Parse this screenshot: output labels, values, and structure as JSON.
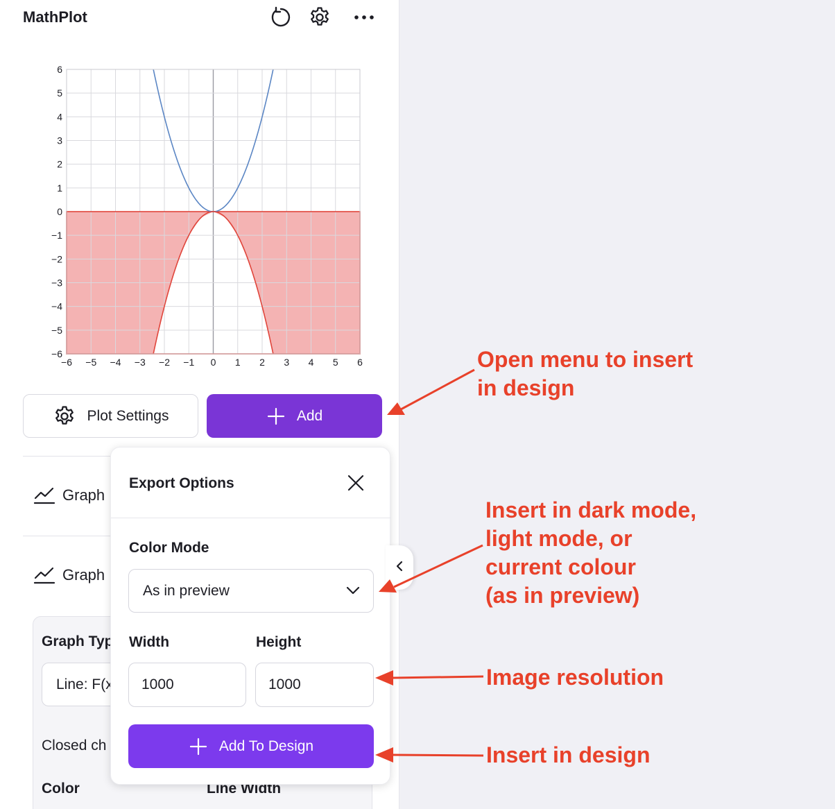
{
  "app": {
    "title": "MathPlot"
  },
  "header": {
    "icons": [
      "refresh-icon",
      "gear-icon",
      "more-icon"
    ]
  },
  "chart_data": {
    "type": "line",
    "x_ticks": [
      "−6",
      "−5",
      "−4",
      "−3",
      "−2",
      "−1",
      "0",
      "1",
      "2",
      "3",
      "4",
      "5",
      "6"
    ],
    "y_ticks": [
      "6",
      "5",
      "4",
      "3",
      "2",
      "1",
      "0",
      "−1",
      "−2",
      "−3",
      "−4",
      "−5",
      "−6"
    ],
    "xlim": [
      -6,
      6
    ],
    "ylim": [
      -6,
      6
    ],
    "grid": true,
    "series": [
      {
        "color": "#5b86c4",
        "x": [
          -2.45,
          -2,
          -1.5,
          -1,
          -0.5,
          0,
          0.5,
          1,
          1.5,
          2,
          2.45
        ],
        "y": [
          6.0,
          4.0,
          2.25,
          1.0,
          0.25,
          0,
          0.25,
          1.0,
          2.25,
          4.0,
          6.0
        ]
      },
      {
        "color": "#e0453b",
        "x": [
          -2.45,
          -2,
          -1.5,
          -1,
          -0.5,
          0,
          0.5,
          1,
          1.5,
          2,
          2.45
        ],
        "y": [
          -6.0,
          -4.0,
          -2.25,
          -1.0,
          -0.25,
          0,
          -0.25,
          -1.0,
          -2.25,
          -4.0,
          -6.0
        ]
      }
    ],
    "region": {
      "color": "#f4b3b3",
      "border": "#e0453b",
      "y_range": [
        -6,
        0
      ],
      "excluded": "inside lower parabola"
    }
  },
  "buttons": {
    "plot_settings": "Plot Settings",
    "add": "Add"
  },
  "graph_items": [
    "Graph",
    "Graph"
  ],
  "sub_card": {
    "graph_type_label": "Graph Typ",
    "graph_type_value": "Line: F(x",
    "closed_label": "Closed ch",
    "color_label": "Color",
    "line_width_label": "Line Width"
  },
  "export": {
    "title": "Export Options",
    "color_mode_label": "Color Mode",
    "color_mode_value": "As in preview",
    "width_label": "Width",
    "height_label": "Height",
    "width_value": "1000",
    "height_value": "1000",
    "add_to_design": "Add To Design"
  },
  "annotations": {
    "open_menu": "Open menu to insert\nin design",
    "color_mode": "Insert in dark mode,\nlight mode, or\ncurrent colour\n(as in preview)",
    "resolution": "Image resolution",
    "insert": "Insert in design"
  },
  "colors": {
    "accent": "#7a35d6",
    "annotation": "#e8412a"
  }
}
